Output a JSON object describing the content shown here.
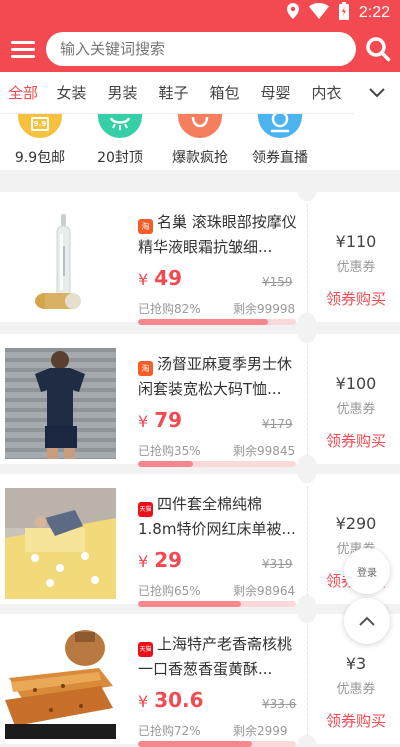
{
  "status_bar": {
    "time": "2:22"
  },
  "search": {
    "placeholder": "输入关键词搜索"
  },
  "tabs": [
    "全部",
    "女装",
    "男装",
    "鞋子",
    "箱包",
    "母婴",
    "内衣"
  ],
  "quick_links": [
    {
      "label": "9.9包邮",
      "badge": "9.9",
      "color": "#f6c23e",
      "icon": "price-tag-icon"
    },
    {
      "label": "20封顶",
      "color": "#35d0a6",
      "icon": "smile-icon"
    },
    {
      "label": "爆款疯抢",
      "color": "#f57e5e",
      "icon": "bag-icon"
    },
    {
      "label": "领券直播",
      "color": "#4bb3ef",
      "icon": "search-icon"
    }
  ],
  "products": [
    {
      "shop": "淘",
      "shop_type": "taobao",
      "title": "名巢 滚珠眼部按摩仪精华液眼霜抗皱细...",
      "yen": "¥",
      "price": "49",
      "original": "¥159",
      "sold": "已抢购82%",
      "sold_fraction": 0.82,
      "remain": "剩余99998",
      "coupon": "¥110",
      "coupon_label": "优惠券",
      "buy": "领券购买"
    },
    {
      "shop": "淘",
      "shop_type": "taobao",
      "title": "汤督亚麻夏季男士休闲套装宽松大码T恤...",
      "yen": "¥",
      "price": "79",
      "original": "¥179",
      "sold": "已抢购35%",
      "sold_fraction": 0.35,
      "remain": "剩余99845",
      "coupon": "¥100",
      "coupon_label": "优惠券",
      "buy": "领券购买"
    },
    {
      "shop": "天猫",
      "shop_type": "tmall",
      "title": "四件套全棉纯棉1.8m特价网红床单被...",
      "yen": "¥",
      "price": "29",
      "original": "¥319",
      "sold": "已抢购65%",
      "sold_fraction": 0.65,
      "remain": "剩余98964",
      "coupon": "¥290",
      "coupon_label": "优惠券",
      "buy": "领券购买"
    },
    {
      "shop": "天猫",
      "shop_type": "tmall",
      "title": "上海特产老香斋核桃一口香葱香蛋黄酥...",
      "yen": "¥",
      "price": "30.6",
      "original": "¥33.6",
      "sold": "已抢购72%",
      "sold_fraction": 0.72,
      "remain": "剩余2999",
      "coupon": "¥3",
      "coupon_label": "优惠券",
      "buy": "领券购买"
    }
  ],
  "float": {
    "login": "登录"
  }
}
